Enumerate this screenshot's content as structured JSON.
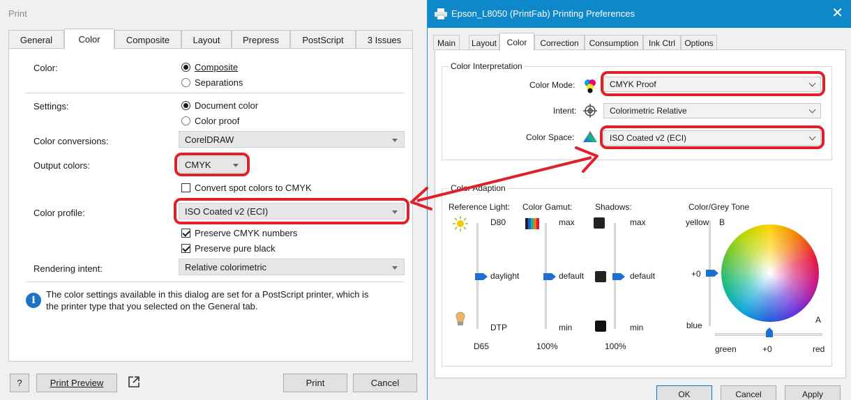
{
  "left": {
    "title": "Print",
    "tabs": [
      "General",
      "Color",
      "Composite",
      "Layout",
      "Prepress",
      "PostScript",
      "3 Issues"
    ],
    "active_tab": "Color",
    "color_label": "Color:",
    "color_opt1": "Composite",
    "color_opt2": "Separations",
    "settings_label": "Settings:",
    "settings_opt1": "Document color",
    "settings_opt2": "Color proof",
    "conversions_label": "Color conversions:",
    "conversions_value": "CorelDRAW",
    "output_label": "Output colors:",
    "output_value": "CMYK",
    "spot_label": "Convert spot colors to CMYK",
    "profile_label": "Color profile:",
    "profile_value": "ISO Coated v2 (ECI)",
    "preserve_cmyk": "Preserve CMYK numbers",
    "preserve_black": "Preserve pure black",
    "intent_label": "Rendering intent:",
    "intent_value": "Relative colorimetric",
    "info_text_1": "The color settings available in this dialog are set for a PostScript printer, which is",
    "info_text_2": "the printer type that you selected on the General tab.",
    "help_button": "?",
    "preview_button": "Print Preview",
    "print_button": "Print",
    "cancel_button": "Cancel"
  },
  "right": {
    "title": "Epson_L8050 (PrintFab) Printing Preferences",
    "close": "✕",
    "tabs": [
      "Main",
      "Layout",
      "Color",
      "Correction",
      "Consumption",
      "Ink Ctrl",
      "Options"
    ],
    "active_tab": "Color",
    "group1_title": "Color Interpretation",
    "mode_label": "Color Mode:",
    "mode_value": "CMYK Proof",
    "intent_label": "Intent:",
    "intent_value": "Colorimetric Relative",
    "space_label": "Color Space:",
    "space_value": "ISO Coated v2 (ECI)",
    "group2_title": "Color Adaption",
    "ref_light": "Reference Light:",
    "d80": "D80",
    "daylight": "daylight",
    "dtp": "DTP",
    "d65": "D65",
    "gamut": "Color Gamut:",
    "gamut_max": "max",
    "gamut_default": "default",
    "gamut_min": "min",
    "gamut_value": "100%",
    "shadows": "Shadows:",
    "shadows_max": "max",
    "shadows_default": "default",
    "shadows_min": "min",
    "shadows_value": "100%",
    "grey_tone": "Color/Grey Tone",
    "yellow": "yellow",
    "b_axis": "B",
    "plus0_v": "+0",
    "blue": "blue",
    "a_axis": "A",
    "green": "green",
    "plus0_h": "+0",
    "red": "red",
    "ok_button": "OK",
    "cancel_button": "Cancel",
    "apply_button": "Apply"
  },
  "colors": {
    "annotation_red": "#e0212b",
    "titlebar_blue": "#0f88c9",
    "info_blue": "#1b74c7"
  }
}
